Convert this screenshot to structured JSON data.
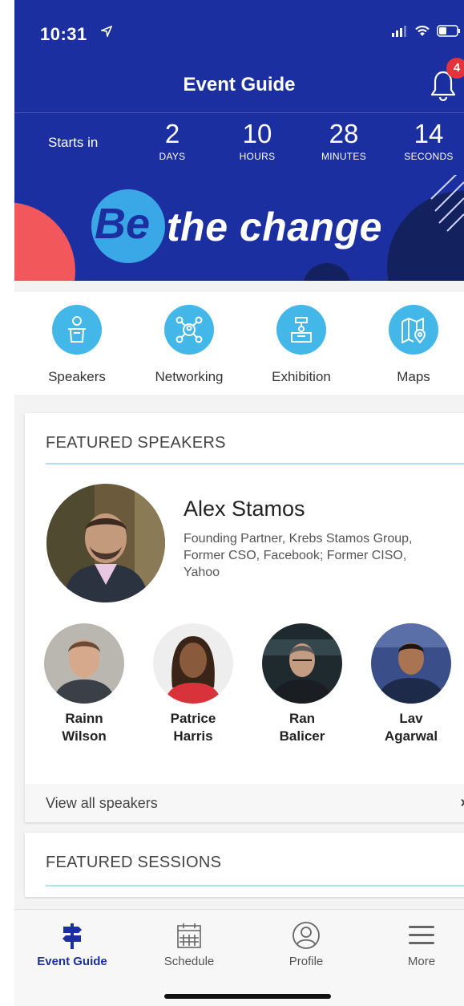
{
  "status_bar": {
    "time": "10:31"
  },
  "header": {
    "title": "Event Guide",
    "notification_count": "4"
  },
  "countdown": {
    "label": "Starts in",
    "units": [
      {
        "value": "2",
        "label": "DAYS"
      },
      {
        "value": "10",
        "label": "HOURS"
      },
      {
        "value": "28",
        "label": "MINUTES"
      },
      {
        "value": "14",
        "label": "SECONDS"
      }
    ]
  },
  "banner": {
    "be": "Be",
    "text": "the change"
  },
  "quick_links": [
    {
      "label": "Speakers",
      "icon": "speaker-podium-icon"
    },
    {
      "label": "Networking",
      "icon": "networking-icon"
    },
    {
      "label": "Exhibition",
      "icon": "exhibition-booth-icon"
    },
    {
      "label": "Maps",
      "icon": "map-icon"
    }
  ],
  "featured_speakers": {
    "title": "FEATURED SPEAKERS",
    "lead": {
      "name": "Alex Stamos",
      "role": "Founding Partner, Krebs Stamos Group, Former CSO, Facebook; Former CISO, Yahoo"
    },
    "speakers": [
      {
        "first": "Rainn",
        "last": "Wilson"
      },
      {
        "first": "Patrice",
        "last": "Harris"
      },
      {
        "first": "Ran",
        "last": "Balicer"
      },
      {
        "first": "Lav",
        "last": "Agarwal"
      }
    ],
    "view_all": "View all speakers"
  },
  "featured_sessions": {
    "title": "FEATURED SESSIONS"
  },
  "tabbar": [
    {
      "label": "Event Guide",
      "icon": "signpost-icon",
      "active": true
    },
    {
      "label": "Schedule",
      "icon": "calendar-icon"
    },
    {
      "label": "Profile",
      "icon": "profile-icon"
    },
    {
      "label": "More",
      "icon": "menu-icon"
    }
  ],
  "colors": {
    "brand_blue": "#1c2fa0",
    "accent_cyan": "#42b7e8",
    "badge_red": "#e5323b",
    "coral": "#f2585b"
  }
}
